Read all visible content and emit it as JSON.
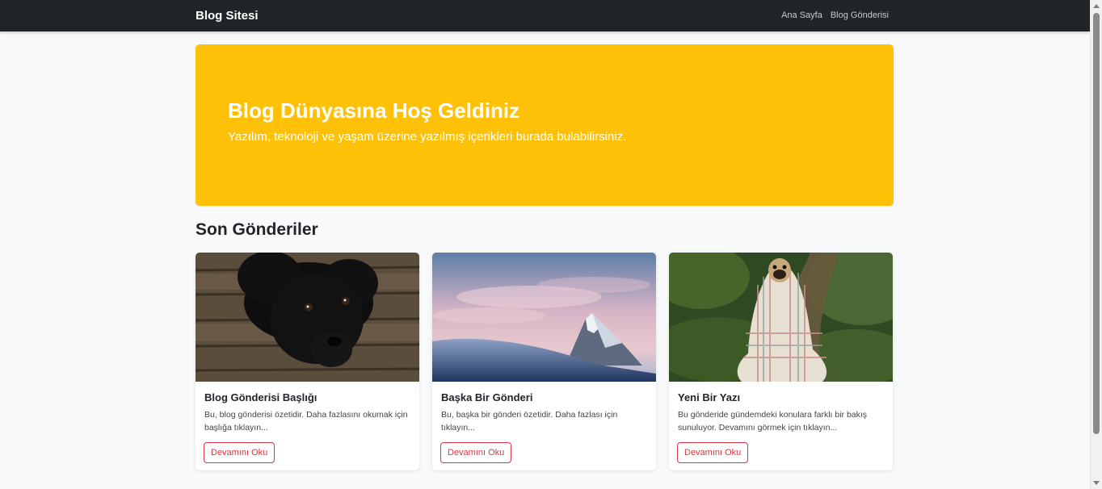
{
  "navbar": {
    "brand": "Blog Sitesi",
    "links": [
      "Ana Sayfa",
      "Blog Gönderisi"
    ],
    "background": "#212529"
  },
  "hero": {
    "title": "Blog Dünyasına Hoş Geldiniz",
    "subtitle": "Yazılım, teknoloji ve yaşam üzerine yazılmış içerikleri burada bulabilirsiniz.",
    "background": "#ffc107"
  },
  "section": {
    "title": "Son Gönderiler"
  },
  "posts": [
    {
      "title": "Blog Gönderisi Başlığı",
      "excerpt": "Bu, blog gönderisi özetidir. Daha fazlasını okumak için başlığa tıklayın...",
      "button": "Devamını Oku",
      "image": "black-puppy-photo"
    },
    {
      "title": "Başka Bir Gönderi",
      "excerpt": "Bu, başka bir gönderi özetidir. Daha fazlası için tıklayın...",
      "button": "Devamını Oku",
      "image": "mountain-peak-photo"
    },
    {
      "title": "Yeni Bir Yazı",
      "excerpt": "Bu gönderide gündemdeki konulara farklı bir bakış sunuluyor. Devamını görmek için tıklayın...",
      "button": "Devamını Oku",
      "image": "pug-in-blanket-photo"
    }
  ],
  "colors": {
    "accent": "#dc3545",
    "page_background": "#f8f9fa"
  }
}
